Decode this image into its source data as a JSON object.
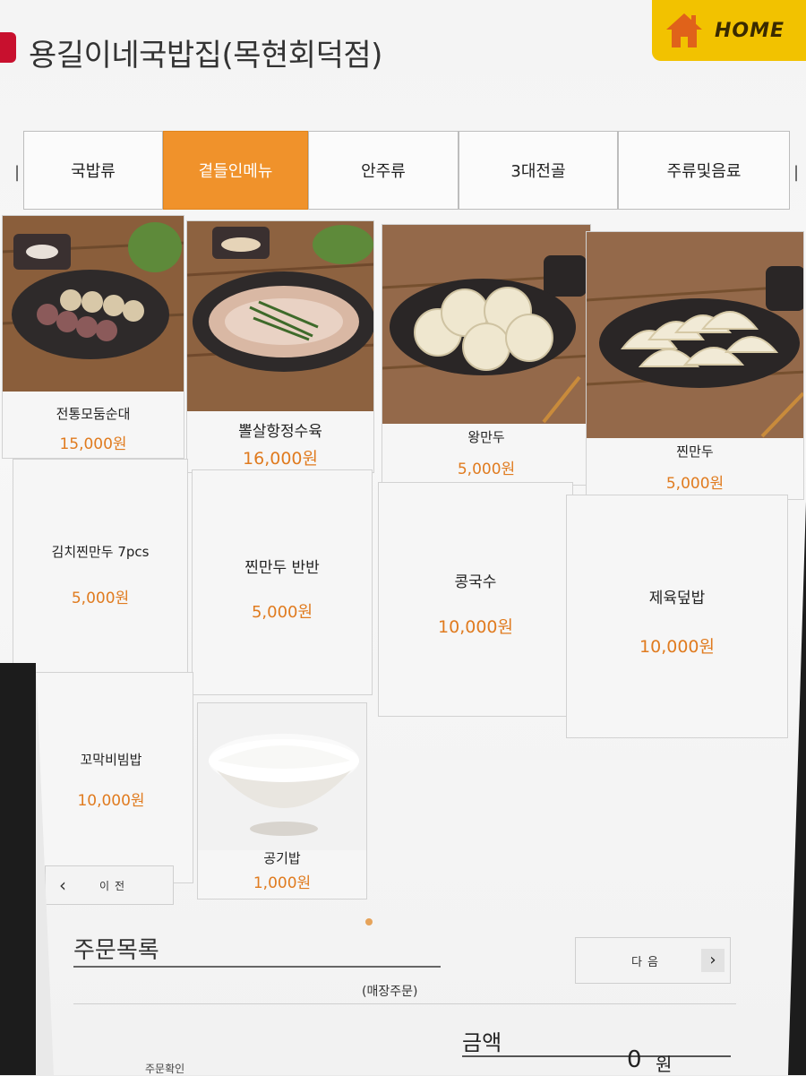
{
  "header": {
    "store_name": "용길이네국밥집(목현회덕점)",
    "home_label": "HOME"
  },
  "tabs": [
    {
      "label": "국밥류",
      "active": false
    },
    {
      "label": "곁들인메뉴",
      "active": true
    },
    {
      "label": "안주류",
      "active": false
    },
    {
      "label": "3대전골",
      "active": false
    },
    {
      "label": "주류및음료",
      "active": false
    }
  ],
  "menu": [
    {
      "name": "전통모둠순대",
      "price": "15,000원",
      "photo": "sundae-platter"
    },
    {
      "name": "뽈살항정수육",
      "price": "16,000원",
      "photo": "pork-suyuk"
    },
    {
      "name": "왕만두",
      "price": "5,000원",
      "photo": "king-dumplings"
    },
    {
      "name": "찐만두",
      "price": "5,000원",
      "photo": "steamed-dumplings"
    },
    {
      "name": "김치찐만두 7pcs",
      "price": "5,000원"
    },
    {
      "name": "찐만두 반반",
      "price": "5,000원"
    },
    {
      "name": "콩국수",
      "price": "10,000원"
    },
    {
      "name": "제육덮밥",
      "price": "10,000원"
    },
    {
      "name": "꼬막비빔밥",
      "price": "10,000원"
    },
    {
      "name": "공기밥",
      "price": "1,000원",
      "photo": "rice-bowl"
    }
  ],
  "pagination": {
    "prev_label": "이전",
    "next_label": "다음"
  },
  "order": {
    "title": "주문목록",
    "type": "(매장주문)",
    "amount_label": "금액",
    "amount_value": "0",
    "amount_unit": "원",
    "history_label": "주문확인"
  },
  "colors": {
    "accent_tab": "#f0922b",
    "price": "#e07b1f",
    "home_button": "#f2c200",
    "logo": "#c8102e"
  }
}
